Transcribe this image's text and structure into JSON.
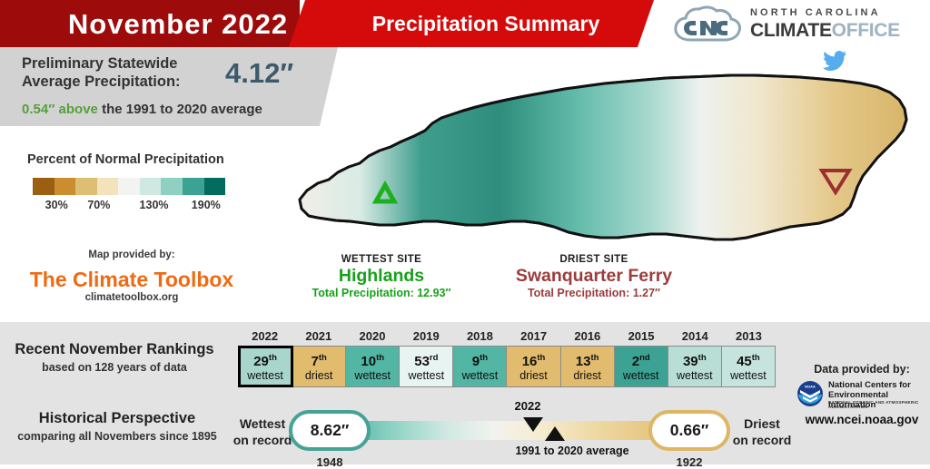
{
  "header": {
    "month_title": "November 2022",
    "report_title": "Precipitation Summary",
    "banner_left_color": "#9e0b0b",
    "banner_right_color": "#d50b0b"
  },
  "logo": {
    "line1": "NORTH CAROLINA",
    "line2_bold": "CLIMATE",
    "line2_light": "OFFICE",
    "cloud_icon": "nc-cloud-logo-icon",
    "social_icon": "twitter-bird-icon",
    "twitter_color": "#55acee"
  },
  "stat": {
    "label": "Preliminary Statewide\nAverage Precipitation:",
    "label_line1": "Preliminary Statewide",
    "label_line2": "Average Precipitation:",
    "value": "4.12″",
    "value_color": "#3d5a6c",
    "departure_amount": "0.54″ above",
    "departure_rest": " the 1991 to 2020 average",
    "departure_color": "#56a03c"
  },
  "legend": {
    "title": "Percent of Normal Precipitation",
    "colors": [
      "#9a5f11",
      "#cc8d2f",
      "#ddbe72",
      "#f2e3bb",
      "#f3f3f1",
      "#cfe9e2",
      "#8ed0c2",
      "#3ba294",
      "#046b5f"
    ],
    "ticks": [
      {
        "label": "30%",
        "pos_pct": 14
      },
      {
        "label": "70%",
        "pos_pct": 36
      },
      {
        "label": "130%",
        "pos_pct": 63
      },
      {
        "label": "190%",
        "pos_pct": 90
      }
    ]
  },
  "toolbox": {
    "pre": "Map provided by:",
    "name": "The Climate Toolbox",
    "url": "climatetoolbox.org",
    "color": "#ef6a12"
  },
  "sites": {
    "wettest": {
      "kicker": "WETTEST SITE",
      "name": "Highlands",
      "total": "Total Precipitation: 12.93″",
      "color": "#17a01a",
      "marker": "up-triangle-marker"
    },
    "driest": {
      "kicker": "DRIEST SITE",
      "name": "Swanquarter Ferry",
      "total": "Total Precipitation: 1.27″",
      "color": "#9b3c3c",
      "marker": "down-triangle-marker"
    }
  },
  "rankings": {
    "heading": "Recent November Rankings",
    "subheading": "based on 128 years of data",
    "years": [
      "2022",
      "2021",
      "2020",
      "2019",
      "2018",
      "2017",
      "2016",
      "2015",
      "2014",
      "2013"
    ],
    "cells": [
      {
        "rank": "29",
        "suffix": "th",
        "label": "wettest",
        "color": "#a8d6cc",
        "current": true
      },
      {
        "rank": "7",
        "suffix": "th",
        "label": "driest",
        "color": "#e2bc6e",
        "current": false
      },
      {
        "rank": "10",
        "suffix": "th",
        "label": "wettest",
        "color": "#53b5a3",
        "current": false
      },
      {
        "rank": "53",
        "suffix": "rd",
        "label": "wettest",
        "color": "#e7f4f1",
        "current": false
      },
      {
        "rank": "9",
        "suffix": "th",
        "label": "wettest",
        "color": "#53b5a3",
        "current": false
      },
      {
        "rank": "16",
        "suffix": "th",
        "label": "driest",
        "color": "#e2bc6e",
        "current": false
      },
      {
        "rank": "13",
        "suffix": "th",
        "label": "driest",
        "color": "#e2bc6e",
        "current": false
      },
      {
        "rank": "2",
        "suffix": "nd",
        "label": "wettest",
        "color": "#3ba294",
        "current": false
      },
      {
        "rank": "39",
        "suffix": "th",
        "label": "wettest",
        "color": "#b8ded5",
        "current": false
      },
      {
        "rank": "45",
        "suffix": "th",
        "label": "wettest",
        "color": "#c6e4dd",
        "current": false
      }
    ]
  },
  "historical": {
    "heading": "Historical Perspective",
    "subheading": "comparing all Novembers since 1895",
    "wettest_side_label": "Wettest\non record",
    "wettest_side_line1": "Wettest",
    "wettest_side_line2": "on record",
    "driest_side_line1": "Driest",
    "driest_side_line2": "on record",
    "wettest_value": "8.62″",
    "wettest_year": "1948",
    "driest_value": "0.66″",
    "driest_year": "1922",
    "marker_current_label": "2022",
    "marker_average_label": "1991 to 2020 average",
    "wettest_pill_border": "#45a396",
    "driest_pill_border": "#ddb765"
  },
  "ncei": {
    "pre": "Data provided by:",
    "line1": "National Centers for",
    "line2": "Environmental Information",
    "line3": "NATIONAL OCEANIC AND ATMOSPHERIC ADMINISTRATION",
    "url": "www.ncei.noaa.gov",
    "seal_icon": "noaa-seal-icon"
  },
  "map": {
    "name": "north-carolina-precipitation-map",
    "background": "#ffffff"
  }
}
